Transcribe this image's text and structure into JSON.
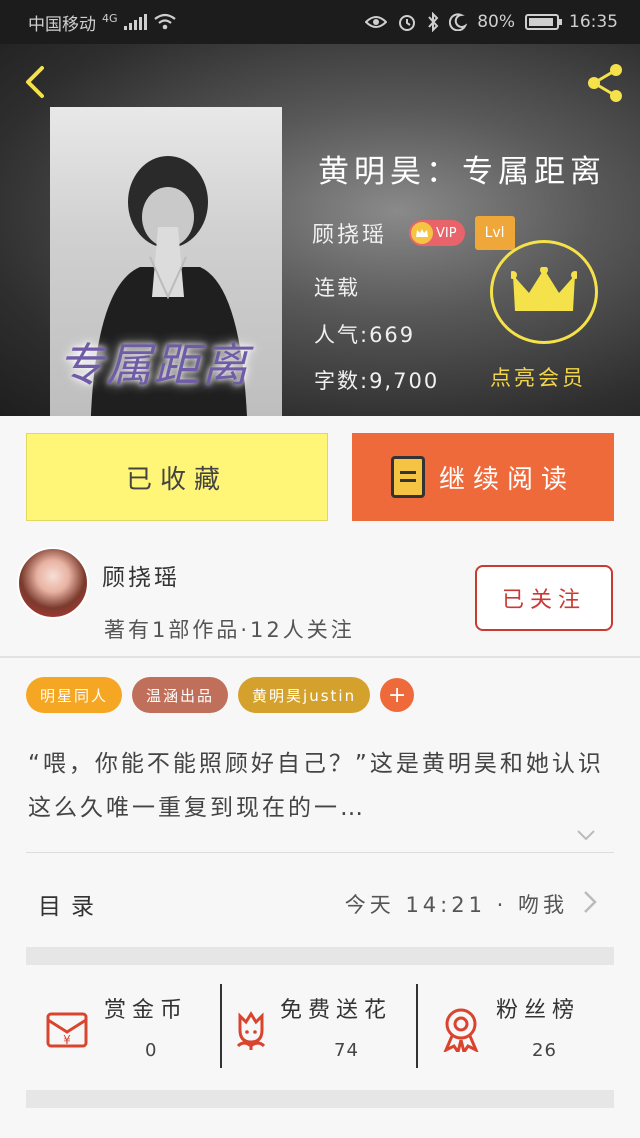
{
  "status_bar": {
    "carrier": "中国移动",
    "network": "4G",
    "battery": "80%",
    "time": "16:35",
    "icons": [
      "eye-icon",
      "alarm-icon",
      "bluetooth-icon",
      "moon-icon",
      "battery-icon"
    ]
  },
  "book": {
    "cover_title": "专属距离",
    "title": "黄明昊：专属距离",
    "author": "顾挠瑶",
    "vip_badge": "VIP",
    "level_badge": "Lvl",
    "status": "连载",
    "popularity": "人气:669",
    "word_count": "字数:9,700"
  },
  "member": {
    "label": "点亮会员",
    "color": "#f5e24a"
  },
  "actions": {
    "collected_label": "已收藏",
    "continue_label": "继续阅读",
    "collected_bg": "#fff576",
    "continue_bg": "#ee6a3a"
  },
  "author_block": {
    "name": "顾挠瑶",
    "stats": "著有1部作品·12人关注",
    "follow_label": "已关注"
  },
  "tags": [
    {
      "label": "明星同人",
      "color": "#f5a623"
    },
    {
      "label": "温涵出品",
      "color": "#c0705a"
    },
    {
      "label": "黄明昊justin",
      "color": "#d4a22c"
    }
  ],
  "tag_add": "+",
  "intro": "“喂，你能不能照顾好自己？”这是黄明昊和她认识这么久唯一重复到现在的一…",
  "toc": {
    "label": "目录",
    "update": "今天 14:21 · 吻我"
  },
  "stats": [
    {
      "label": "赏金币",
      "value": "0",
      "icon": "red-envelope-icon"
    },
    {
      "label": "免费送花",
      "value": "74",
      "icon": "flower-icon"
    },
    {
      "label": "粉丝榜",
      "value": "26",
      "icon": "medal-icon"
    }
  ]
}
